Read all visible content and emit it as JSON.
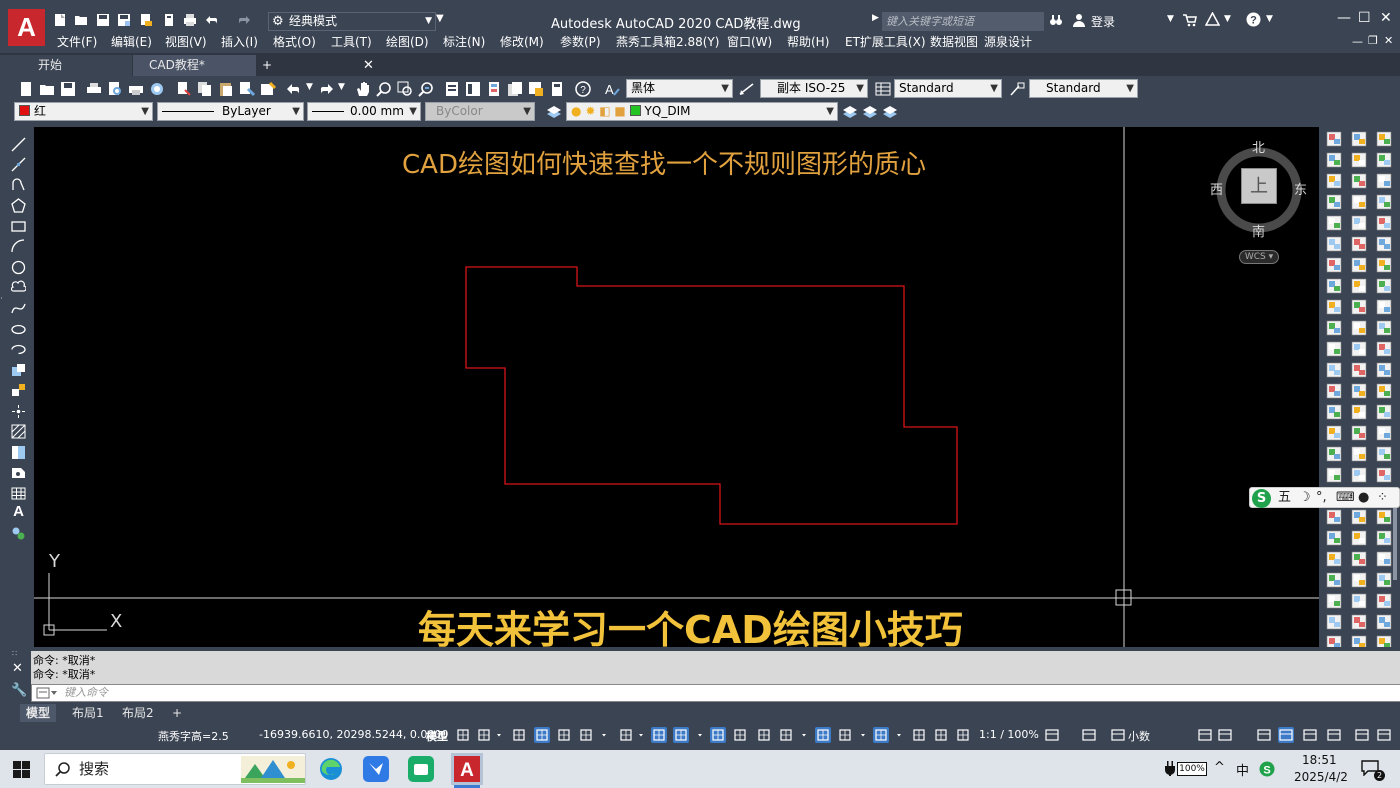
{
  "app": {
    "logo_letter": "A",
    "title": "Autodesk AutoCAD 2020    CAD教程.dwg",
    "workspace": "经典模式",
    "search_placeholder": "键入关键字或短语",
    "login": "登录"
  },
  "menu": [
    "文件(F)",
    "编辑(E)",
    "视图(V)",
    "插入(I)",
    "格式(O)",
    "工具(T)",
    "绘图(D)",
    "标注(N)",
    "修改(M)",
    "参数(P)",
    "燕秀工具箱2.88(Y)",
    "窗口(W)",
    "帮助(H)",
    "ET扩展工具(X)",
    "数据视图",
    "源泉设计"
  ],
  "tabs": {
    "start": "开始",
    "drawing": "CAD教程*",
    "close": "✕",
    "add": "+"
  },
  "toolbar1": {
    "text_style_font": "黑体",
    "dim_style": "副本 ISO-25",
    "table_style": "Standard",
    "multileader_style": "Standard"
  },
  "toolbar2": {
    "color": "红",
    "color_hex": "#e01010",
    "linetype": "ByLayer",
    "lineweight": "0.00 mm",
    "plotstyle": "ByColor",
    "layer": "YQ_DIM",
    "layer_color_hex": "#22c322"
  },
  "canvas": {
    "caption_top": "CAD绘图如何快速查找一个不规则图形的质心",
    "caption_bottom": "每天来学习一个CAD绘图小技巧",
    "polygon_color": "#d8141a",
    "ucs_y": "Y",
    "ucs_x": "X"
  },
  "viewcube": {
    "north": "北",
    "south": "南",
    "west": "西",
    "east": "东",
    "face": "上",
    "wcs": "WCS"
  },
  "ime": {
    "logo": "S",
    "mode": "五"
  },
  "command": {
    "history": [
      "命令: *取消*",
      "命令: *取消*"
    ],
    "placeholder": "键入命令"
  },
  "layouts": [
    "模型",
    "布局1",
    "布局2"
  ],
  "layout_add": "+",
  "status": {
    "plugin_text": "燕秀字高=2.5",
    "coordinates": "-16939.6610, 20298.5244, 0.0000",
    "model_label": "模型",
    "annotation_scale": "1:1 / 100%",
    "units": "小数"
  },
  "taskbar": {
    "search": "搜索",
    "battery": "100%",
    "ime_lang": "中",
    "time": "18:51",
    "date": "2025/4/2",
    "notification_count": "2"
  }
}
